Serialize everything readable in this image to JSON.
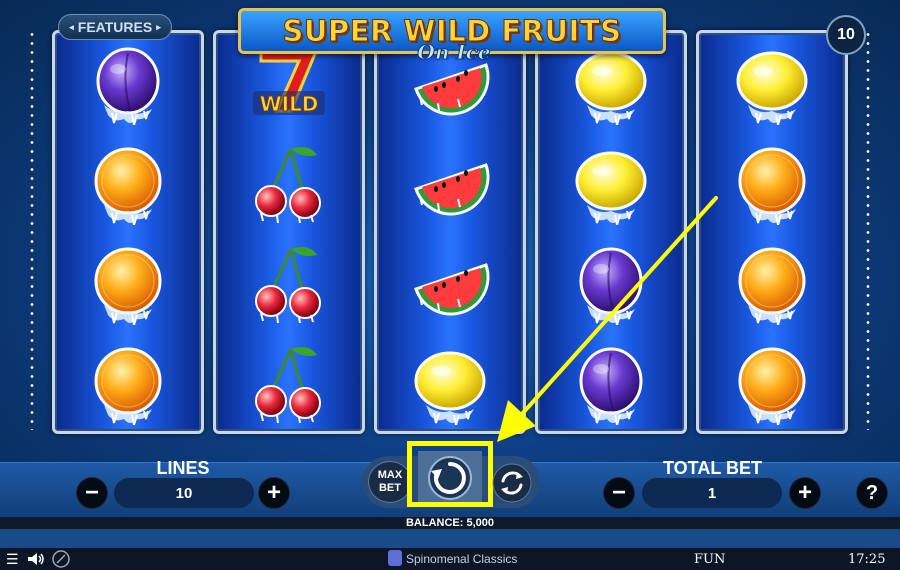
{
  "game": {
    "title_main": "SUPER WILD FRUITS",
    "title_sub": "On Ice",
    "features_label": "FEATURES",
    "lines_badge": "10"
  },
  "reels": [
    [
      "plum",
      "orange",
      "orange",
      "orange"
    ],
    [
      "wild-seven",
      "cherry",
      "cherry",
      "cherry"
    ],
    [
      "watermelon",
      "watermelon",
      "watermelon",
      "lemon"
    ],
    [
      "lemon",
      "lemon",
      "plum",
      "plum"
    ],
    [
      "lemon",
      "orange",
      "orange",
      "orange"
    ]
  ],
  "wild_label": "WILD",
  "controls": {
    "lines_label": "LINES",
    "lines_value": "10",
    "total_bet_label": "TOTAL BET",
    "total_bet_value": "1",
    "max_bet_label": "MAX\nBET",
    "minus": "−",
    "plus": "+",
    "help": "?"
  },
  "balance_text": "BALANCE: 5,000",
  "footer": {
    "provider": "Spinomenal Classics",
    "mode": "FUN",
    "time": "17:25"
  },
  "colors": {
    "highlight": "#ffff00",
    "title_text": "#ffd43a",
    "bar": "#1f5aa6"
  }
}
